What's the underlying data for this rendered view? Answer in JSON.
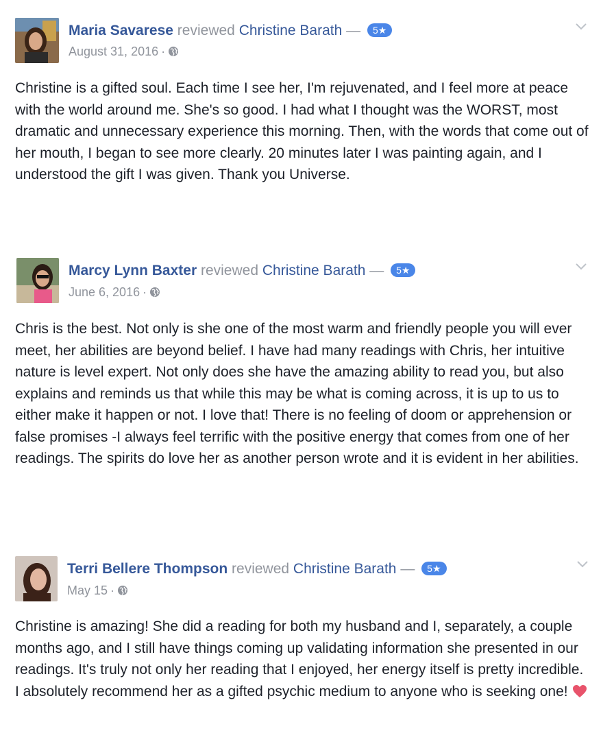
{
  "reviews": [
    {
      "author": "Maria Savarese",
      "verb": "reviewed",
      "page": "Christine Barath",
      "dash": "—",
      "rating": "5★",
      "date": "August 31, 2016",
      "separator": "·",
      "privacy_icon": "globe-icon",
      "text": "Christine is a gifted soul. Each time I see her, I'm rejuvenated, and I feel more at peace with the world around me. She's so good. I had what I thought was the WORST, most dramatic and unnecessary experience this morning. Then, with the words that come out of her mouth, I began to see more clearly. 20 minutes later I was painting again, and I understood the gift I was given. Thank you Universe."
    },
    {
      "author": "Marcy Lynn Baxter",
      "verb": "reviewed",
      "page": "Christine Barath",
      "dash": "—",
      "rating": "5★",
      "date": "June 6, 2016",
      "separator": "·",
      "privacy_icon": "globe-icon",
      "text": "Chris is the best. Not only is she one of the most warm and friendly people you will ever meet, her abilities are beyond belief. I have had many readings with Chris, her intuitive nature is level expert. Not only does she have the amazing ability to read you, but also explains and reminds us that while this may be what is coming across, it is up to us to either make it happen or not. I love that! There is no feeling of doom or apprehension or false promises -I always feel terrific with the positive energy that comes from one of her readings. The spirits do love her as another person wrote and it is evident in her abilities."
    },
    {
      "author": "Terri Bellere Thompson",
      "verb": "reviewed",
      "page": "Christine Barath",
      "dash": "—",
      "rating": "5★",
      "date": "May 15",
      "separator": "·",
      "privacy_icon": "globe-icon",
      "text": "Christine is amazing! She did a reading for both my husband and I, separately, a couple months ago, and I still have things coming up validating information she presented in our readings. It's truly not only her reading that I enjoyed, her energy itself is pretty incredible. I absolutely recommend her as a gifted psychic medium to anyone who is seeking one!",
      "emoji": "heart-icon"
    }
  ],
  "colors": {
    "link": "#365899",
    "meta": "#90949c",
    "badge": "#4a86e8",
    "heart": "#e8536b"
  }
}
